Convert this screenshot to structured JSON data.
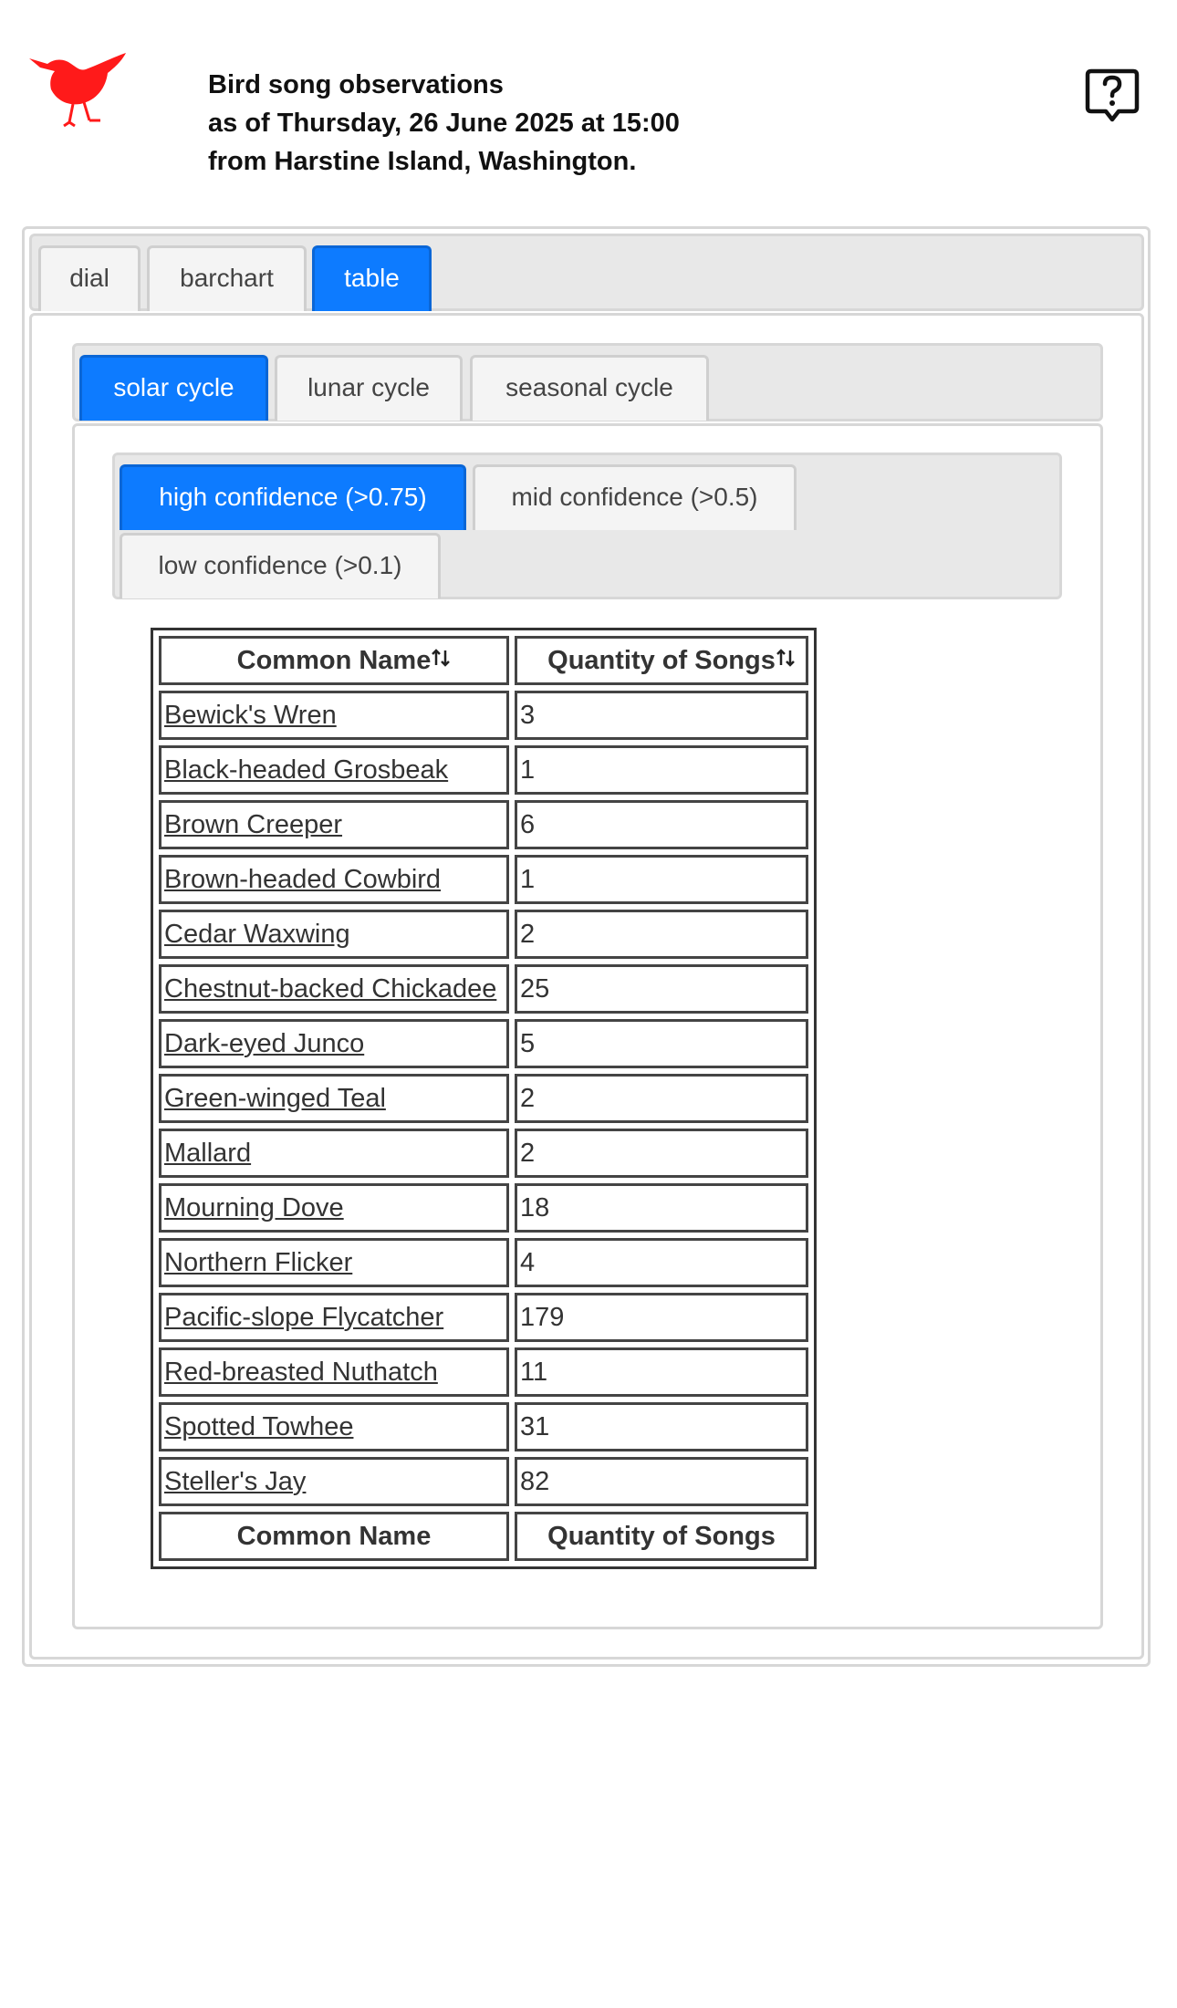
{
  "header": {
    "line1": "Bird song observations",
    "line2": "as of Thursday, 26 June 2025 at 15:00",
    "line3": "from Harstine Island, Washington."
  },
  "colors": {
    "accent": "#0d7bff",
    "logo": "#ff1a1a"
  },
  "icons": {
    "logo": "bird-icon",
    "help": "help-speech-icon",
    "sort": "sort-arrows-icon"
  },
  "view_tabs": [
    {
      "label": "dial",
      "active": false
    },
    {
      "label": "barchart",
      "active": false
    },
    {
      "label": "table",
      "active": true
    }
  ],
  "cycle_tabs": [
    {
      "label": "solar cycle",
      "active": true
    },
    {
      "label": "lunar cycle",
      "active": false
    },
    {
      "label": "seasonal cycle",
      "active": false
    }
  ],
  "confidence_tabs": [
    {
      "label": "high confidence (>0.75)",
      "active": true
    },
    {
      "label": "mid confidence (>0.5)",
      "active": false
    },
    {
      "label": "low confidence (>0.1)",
      "active": false
    }
  ],
  "table": {
    "columns": [
      "Common Name",
      "Quantity of Songs"
    ],
    "rows": [
      {
        "name": "Bewick's Wren",
        "quantity": "3"
      },
      {
        "name": "Black-headed Grosbeak",
        "quantity": "1"
      },
      {
        "name": "Brown Creeper",
        "quantity": "6"
      },
      {
        "name": "Brown-headed Cowbird",
        "quantity": "1"
      },
      {
        "name": "Cedar Waxwing",
        "quantity": "2"
      },
      {
        "name": "Chestnut-backed Chickadee",
        "quantity": "25"
      },
      {
        "name": "Dark-eyed Junco",
        "quantity": "5"
      },
      {
        "name": "Green-winged Teal",
        "quantity": "2"
      },
      {
        "name": "Mallard",
        "quantity": "2"
      },
      {
        "name": "Mourning Dove",
        "quantity": "18"
      },
      {
        "name": "Northern Flicker",
        "quantity": "4"
      },
      {
        "name": "Pacific-slope Flycatcher",
        "quantity": "179"
      },
      {
        "name": "Red-breasted Nuthatch",
        "quantity": "11"
      },
      {
        "name": "Spotted Towhee",
        "quantity": "31"
      },
      {
        "name": "Steller's Jay",
        "quantity": "82"
      }
    ],
    "footer": [
      "Common Name",
      "Quantity of Songs"
    ]
  }
}
